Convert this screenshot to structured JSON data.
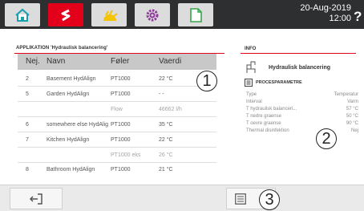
{
  "topbar": {
    "tabs": [
      {
        "icon": "home-icon"
      },
      {
        "icon": "flow-arrows-icon"
      },
      {
        "icon": "sun-icon"
      },
      {
        "icon": "gear-icon"
      },
      {
        "icon": "document-icon"
      }
    ],
    "date": "20-Aug-2019",
    "time": "12:00",
    "help": "?"
  },
  "applikation": {
    "title": "APPLIKATION 'Hydraulisk balancering'",
    "headers": {
      "nej": "Nej.",
      "navn": "Navn",
      "foler": "Føler",
      "vaerdi": "Vaerdi"
    },
    "rows": [
      {
        "nej": "2",
        "navn": "Basement HydAlign",
        "foler": "PT1000",
        "vaerdi": "22 °C"
      },
      {
        "nej": "5",
        "navn": "Garden HydAlign",
        "foler": "PT1000",
        "vaerdi": "- -"
      },
      {
        "nej": "",
        "navn": "",
        "foler": "Flow",
        "vaerdi": "46662 l/h"
      },
      {
        "nej": "6",
        "navn": "somewhere else HydAlig",
        "foler": "PT1000",
        "vaerdi": "35 °C"
      },
      {
        "nej": "7",
        "navn": "Kitchen HydAlign",
        "foler": "PT1000",
        "vaerdi": "22 °C"
      },
      {
        "nej": "",
        "navn": "",
        "foler": "PT1000 eks",
        "vaerdi": "26 °C"
      },
      {
        "nej": "8",
        "navn": "Bathroom HydAlign",
        "foler": "PT1000",
        "vaerdi": "21 °C"
      }
    ]
  },
  "info": {
    "title": "INFO",
    "name": "Hydraulisk balancering",
    "procesparametre_title": "PROCESPARAMETRE",
    "params": [
      {
        "label": "Type",
        "value": "Temperatur"
      },
      {
        "label": "Interval",
        "value": "Varm"
      },
      {
        "label": "T hydraulisk balanceri...",
        "value": "57 °C"
      },
      {
        "label": "T nedre graense",
        "value": "50 °C"
      },
      {
        "label": "T oevre graense",
        "value": "90 °C"
      },
      {
        "label": "Thermal disinfektion",
        "value": "Nej"
      }
    ]
  },
  "callouts": [
    "1",
    "2",
    "3"
  ],
  "colors": {
    "accent": "#e3001b",
    "topbar": "#2e2f31",
    "tab": "#dcdcdc"
  }
}
